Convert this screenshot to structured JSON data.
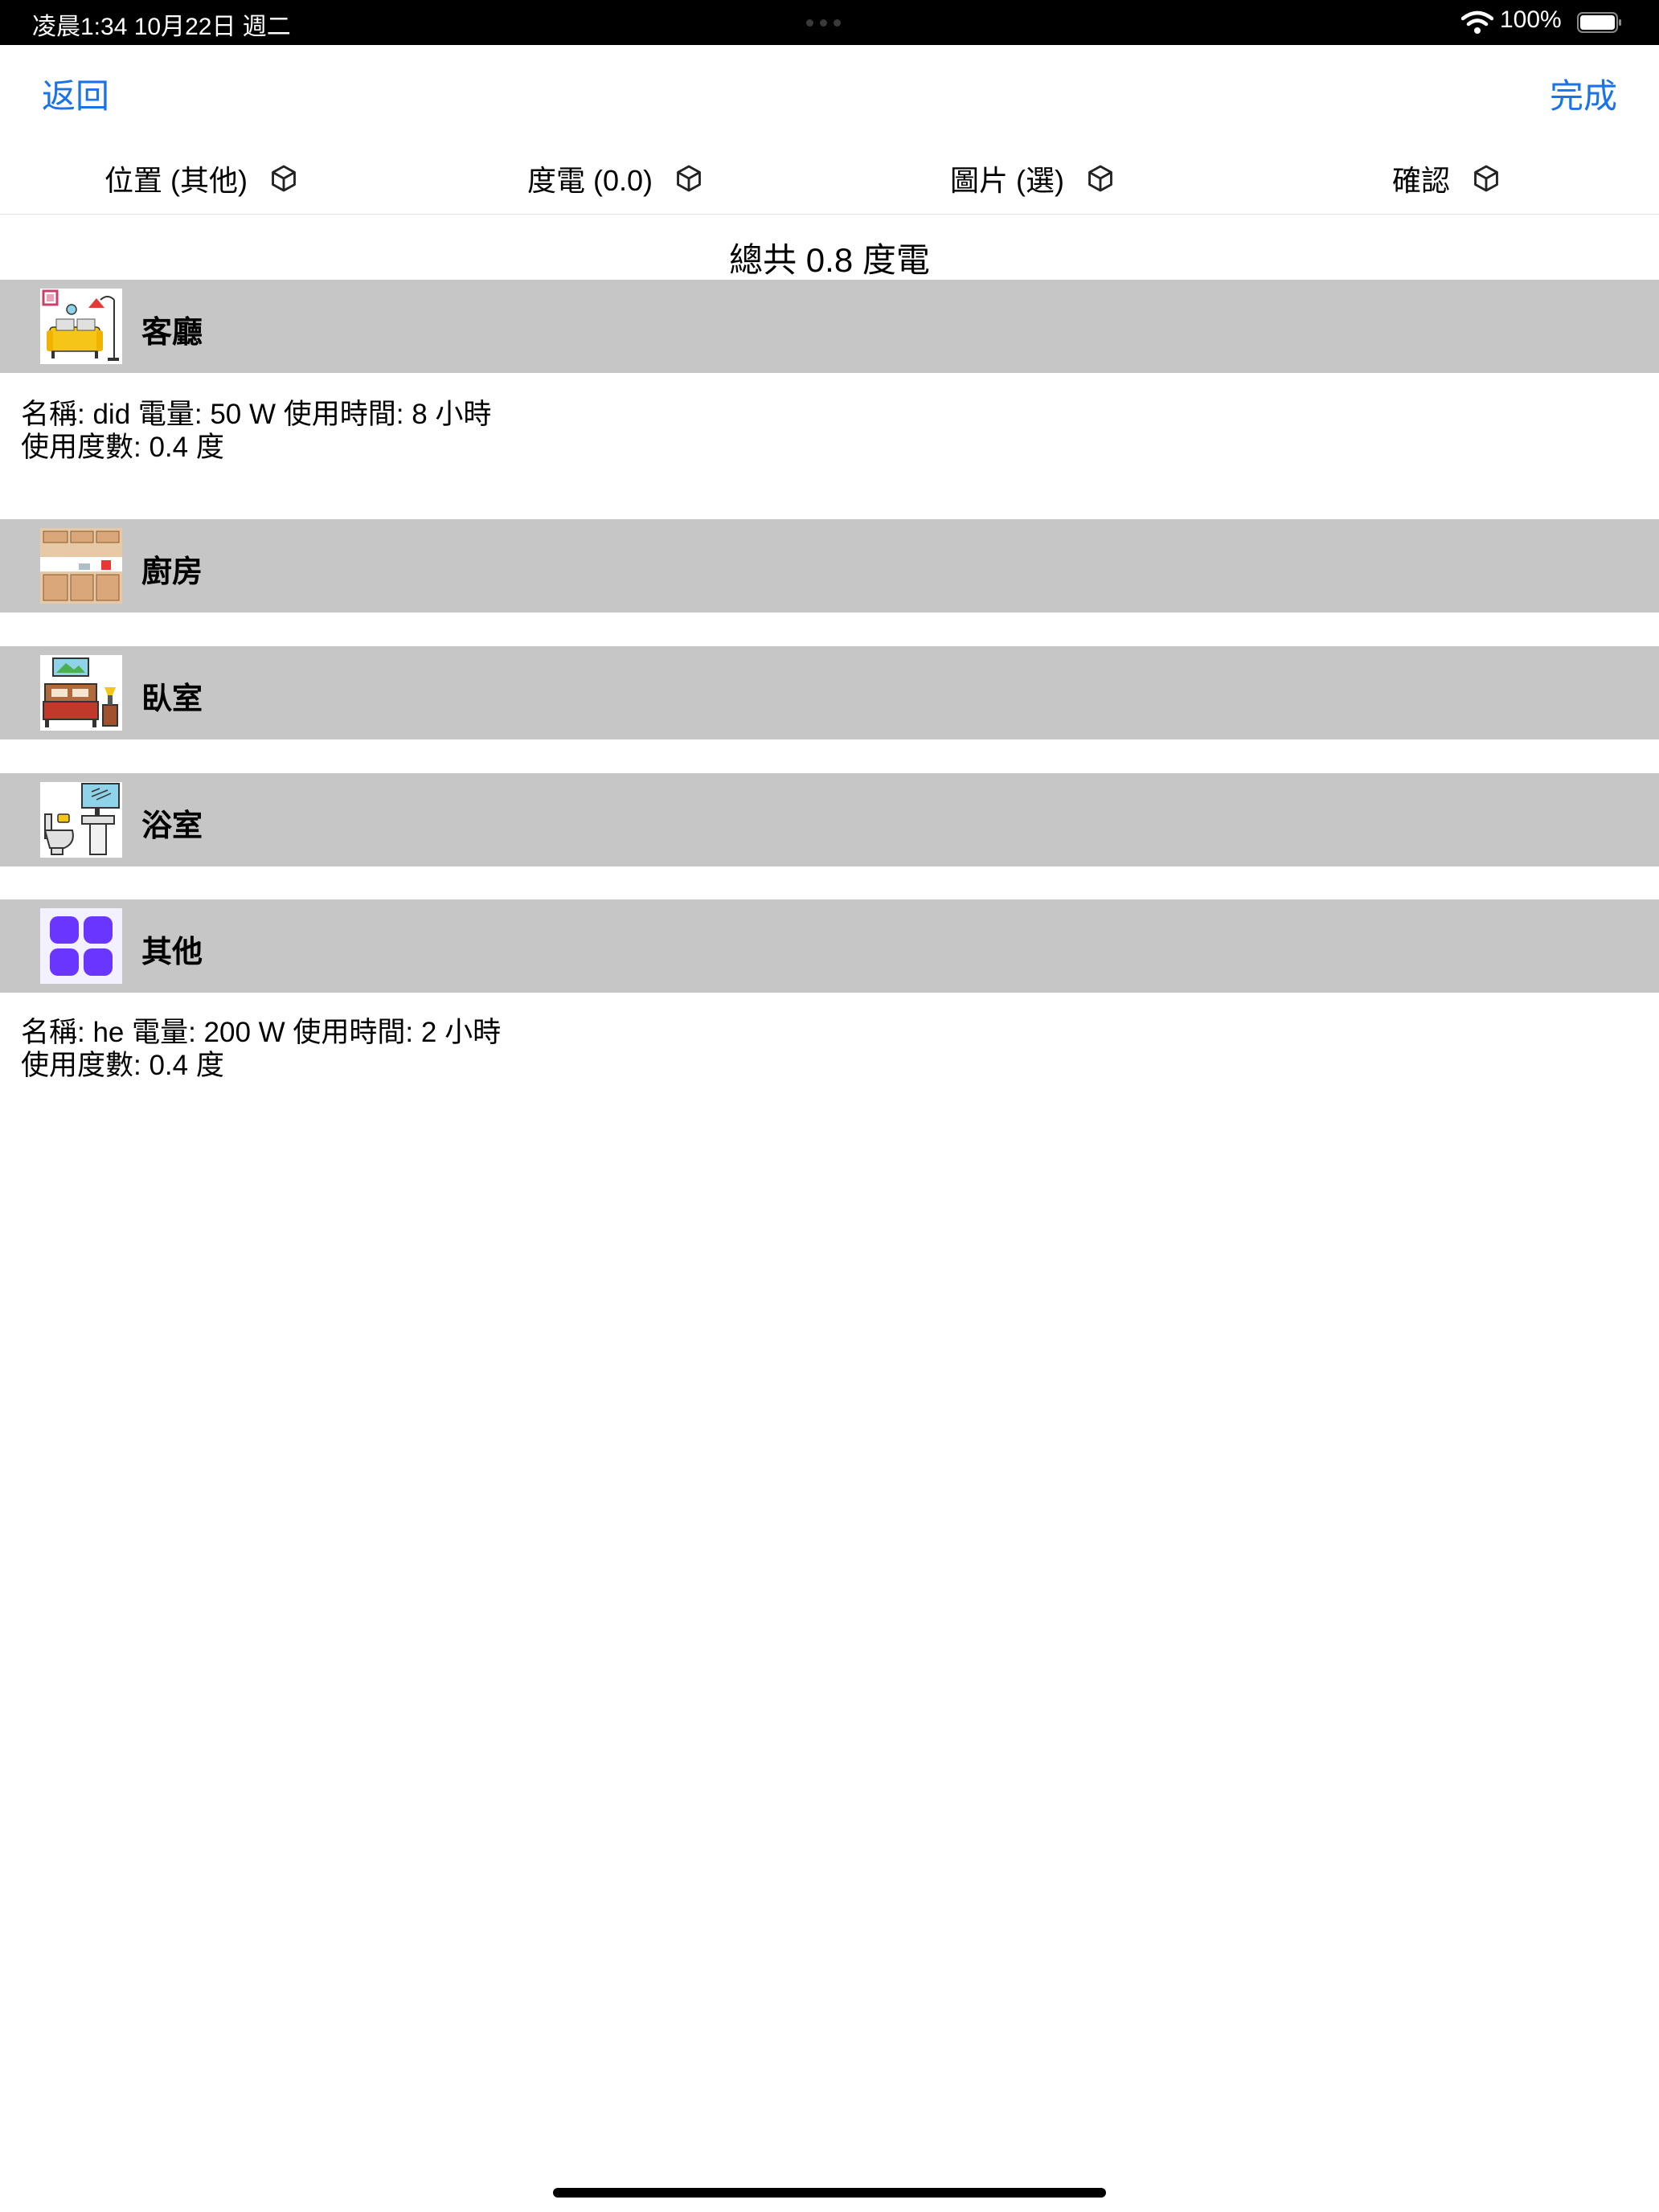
{
  "status_bar": {
    "time": "凌晨1:34   10月22日 週二",
    "battery_percent": "100%",
    "battery_level": 1.0
  },
  "nav": {
    "back_label": "返回",
    "done_label": "完成"
  },
  "tabs": [
    {
      "label": "位置 (其他)",
      "icon": "cube-icon"
    },
    {
      "label": "度電 (0.0)",
      "icon": "cube-icon"
    },
    {
      "label": "圖片 (選)",
      "icon": "cube-icon"
    },
    {
      "label": "確認",
      "icon": "cube-icon"
    }
  ],
  "total": "總共 0.8 度電",
  "sections": [
    {
      "name": "客廳",
      "icon": "living-room-icon",
      "entries": [
        {
          "line1": "名稱: did  電量: 50 W  使用時間: 8 小時",
          "line2": "使用度數: 0.4 度"
        }
      ]
    },
    {
      "name": "廚房",
      "icon": "kitchen-icon",
      "entries": []
    },
    {
      "name": "臥室",
      "icon": "bedroom-icon",
      "entries": []
    },
    {
      "name": "浴室",
      "icon": "bathroom-icon",
      "entries": []
    },
    {
      "name": "其他",
      "icon": "other-grid-icon",
      "entries": [
        {
          "line1": "名稱: he  電量: 200 W  使用時間: 2 小時",
          "line2": "使用度數: 0.4 度"
        }
      ]
    }
  ]
}
